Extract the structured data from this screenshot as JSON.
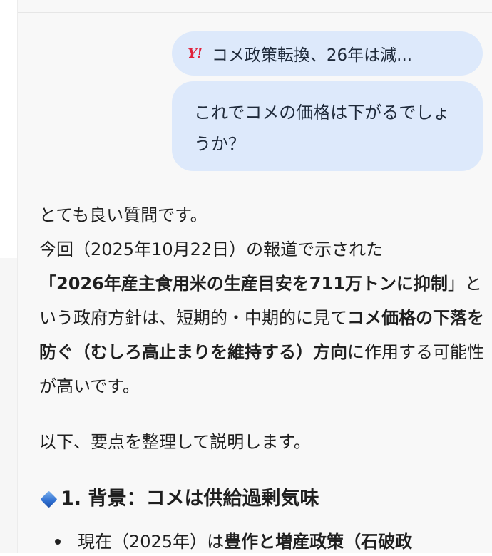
{
  "user_message": {
    "attachment_label": "コメ政策転換、26年は減...",
    "attachment_icon": "yahoo-icon",
    "attachment_icon_text": "Y!",
    "question": "これでコメの価格は下がるでしょうか？"
  },
  "answer": {
    "intro": "とても良い質問です。",
    "line2_pre": "今回（2025年10月22日）の報道で示された",
    "bold_policy": "「2026年産主食用米の生産目安を711万トンに抑制",
    "line3_mid": "」という政府方針は、短期的・中期的に見て",
    "bold_direction": "コメ価格の下落を防ぐ（むしろ高止まりを維持する）方向",
    "line_end": "に作用する可能性が高いです。",
    "summary": "以下、要点を整理して説明します。",
    "section_heading": "1. 背景：コメは供給過剰気味",
    "bullet_pre": "現在（2025年）は",
    "bullet_bold": "豊作と増産政策（石破政"
  },
  "colors": {
    "bubble": "#dde9fb",
    "chat_background": "#f8f8f8",
    "yahoo_red": "#e0213a",
    "diamond_blue": "#2f6fd0"
  }
}
